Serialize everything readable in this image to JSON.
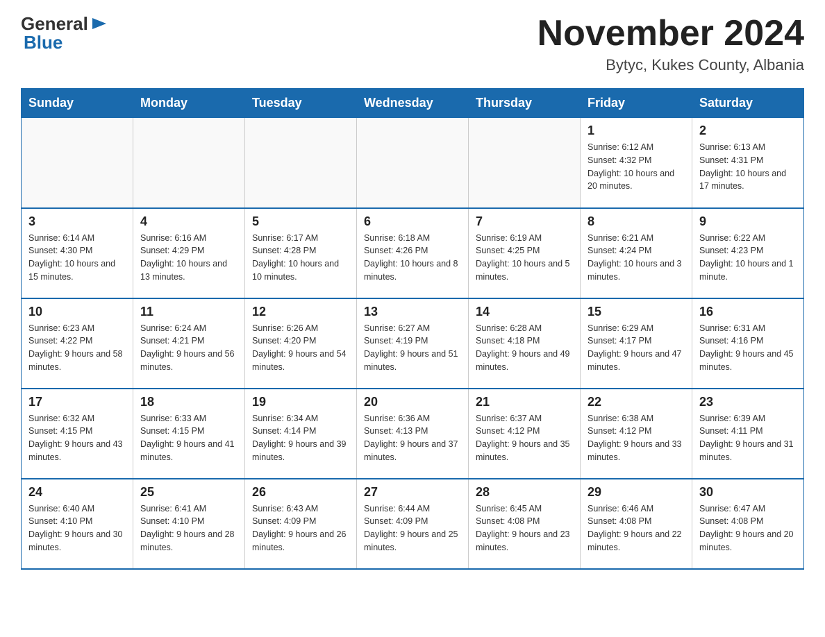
{
  "header": {
    "logo": {
      "general": "General",
      "arrow": "▶",
      "blue": "Blue"
    },
    "title": "November 2024",
    "location": "Bytyc, Kukes County, Albania"
  },
  "days_of_week": [
    "Sunday",
    "Monday",
    "Tuesday",
    "Wednesday",
    "Thursday",
    "Friday",
    "Saturday"
  ],
  "weeks": [
    [
      {
        "day": "",
        "info": ""
      },
      {
        "day": "",
        "info": ""
      },
      {
        "day": "",
        "info": ""
      },
      {
        "day": "",
        "info": ""
      },
      {
        "day": "",
        "info": ""
      },
      {
        "day": "1",
        "info": "Sunrise: 6:12 AM\nSunset: 4:32 PM\nDaylight: 10 hours and 20 minutes."
      },
      {
        "day": "2",
        "info": "Sunrise: 6:13 AM\nSunset: 4:31 PM\nDaylight: 10 hours and 17 minutes."
      }
    ],
    [
      {
        "day": "3",
        "info": "Sunrise: 6:14 AM\nSunset: 4:30 PM\nDaylight: 10 hours and 15 minutes."
      },
      {
        "day": "4",
        "info": "Sunrise: 6:16 AM\nSunset: 4:29 PM\nDaylight: 10 hours and 13 minutes."
      },
      {
        "day": "5",
        "info": "Sunrise: 6:17 AM\nSunset: 4:28 PM\nDaylight: 10 hours and 10 minutes."
      },
      {
        "day": "6",
        "info": "Sunrise: 6:18 AM\nSunset: 4:26 PM\nDaylight: 10 hours and 8 minutes."
      },
      {
        "day": "7",
        "info": "Sunrise: 6:19 AM\nSunset: 4:25 PM\nDaylight: 10 hours and 5 minutes."
      },
      {
        "day": "8",
        "info": "Sunrise: 6:21 AM\nSunset: 4:24 PM\nDaylight: 10 hours and 3 minutes."
      },
      {
        "day": "9",
        "info": "Sunrise: 6:22 AM\nSunset: 4:23 PM\nDaylight: 10 hours and 1 minute."
      }
    ],
    [
      {
        "day": "10",
        "info": "Sunrise: 6:23 AM\nSunset: 4:22 PM\nDaylight: 9 hours and 58 minutes."
      },
      {
        "day": "11",
        "info": "Sunrise: 6:24 AM\nSunset: 4:21 PM\nDaylight: 9 hours and 56 minutes."
      },
      {
        "day": "12",
        "info": "Sunrise: 6:26 AM\nSunset: 4:20 PM\nDaylight: 9 hours and 54 minutes."
      },
      {
        "day": "13",
        "info": "Sunrise: 6:27 AM\nSunset: 4:19 PM\nDaylight: 9 hours and 51 minutes."
      },
      {
        "day": "14",
        "info": "Sunrise: 6:28 AM\nSunset: 4:18 PM\nDaylight: 9 hours and 49 minutes."
      },
      {
        "day": "15",
        "info": "Sunrise: 6:29 AM\nSunset: 4:17 PM\nDaylight: 9 hours and 47 minutes."
      },
      {
        "day": "16",
        "info": "Sunrise: 6:31 AM\nSunset: 4:16 PM\nDaylight: 9 hours and 45 minutes."
      }
    ],
    [
      {
        "day": "17",
        "info": "Sunrise: 6:32 AM\nSunset: 4:15 PM\nDaylight: 9 hours and 43 minutes."
      },
      {
        "day": "18",
        "info": "Sunrise: 6:33 AM\nSunset: 4:15 PM\nDaylight: 9 hours and 41 minutes."
      },
      {
        "day": "19",
        "info": "Sunrise: 6:34 AM\nSunset: 4:14 PM\nDaylight: 9 hours and 39 minutes."
      },
      {
        "day": "20",
        "info": "Sunrise: 6:36 AM\nSunset: 4:13 PM\nDaylight: 9 hours and 37 minutes."
      },
      {
        "day": "21",
        "info": "Sunrise: 6:37 AM\nSunset: 4:12 PM\nDaylight: 9 hours and 35 minutes."
      },
      {
        "day": "22",
        "info": "Sunrise: 6:38 AM\nSunset: 4:12 PM\nDaylight: 9 hours and 33 minutes."
      },
      {
        "day": "23",
        "info": "Sunrise: 6:39 AM\nSunset: 4:11 PM\nDaylight: 9 hours and 31 minutes."
      }
    ],
    [
      {
        "day": "24",
        "info": "Sunrise: 6:40 AM\nSunset: 4:10 PM\nDaylight: 9 hours and 30 minutes."
      },
      {
        "day": "25",
        "info": "Sunrise: 6:41 AM\nSunset: 4:10 PM\nDaylight: 9 hours and 28 minutes."
      },
      {
        "day": "26",
        "info": "Sunrise: 6:43 AM\nSunset: 4:09 PM\nDaylight: 9 hours and 26 minutes."
      },
      {
        "day": "27",
        "info": "Sunrise: 6:44 AM\nSunset: 4:09 PM\nDaylight: 9 hours and 25 minutes."
      },
      {
        "day": "28",
        "info": "Sunrise: 6:45 AM\nSunset: 4:08 PM\nDaylight: 9 hours and 23 minutes."
      },
      {
        "day": "29",
        "info": "Sunrise: 6:46 AM\nSunset: 4:08 PM\nDaylight: 9 hours and 22 minutes."
      },
      {
        "day": "30",
        "info": "Sunrise: 6:47 AM\nSunset: 4:08 PM\nDaylight: 9 hours and 20 minutes."
      }
    ]
  ]
}
